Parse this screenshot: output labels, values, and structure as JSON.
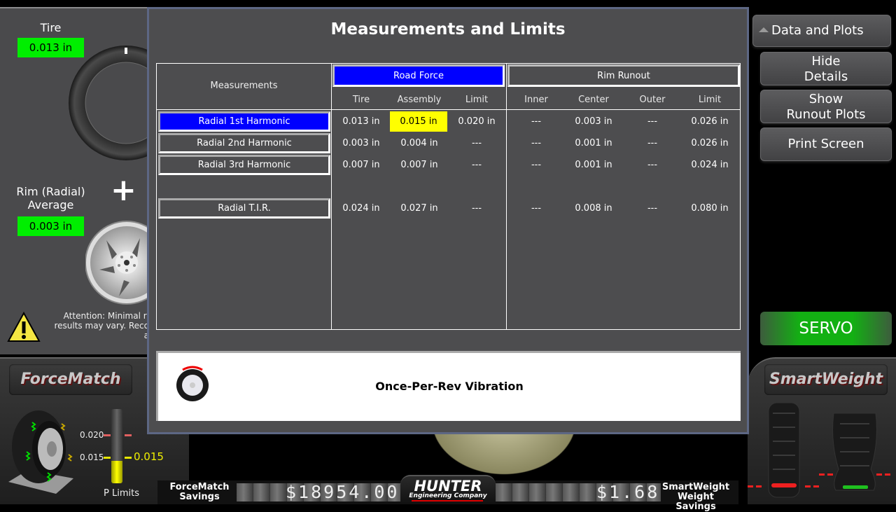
{
  "left_panel": {
    "tire_label": "Tire",
    "tire_value": "0.013 in",
    "rim_label_line1": "Rim (Radial)",
    "rim_label_line2": "Average",
    "rim_value": "0.003 in",
    "plus_sign": "+",
    "attention_line1": "Attention: Minimal ri",
    "attention_line2": "results may vary. Reco",
    "attention_line3": "a"
  },
  "modal": {
    "title": "Measurements and Limits",
    "measurements_header": "Measurements",
    "groups": {
      "road_force": "Road Force",
      "rim_runout": "Rim Runout"
    },
    "columns": {
      "road_force": [
        "Tire",
        "Assembly",
        "Limit"
      ],
      "rim_runout": [
        "Inner",
        "Center",
        "Outer",
        "Limit"
      ]
    },
    "rows": [
      {
        "label": "Radial 1st Harmonic",
        "selected": true,
        "road_force": [
          "0.013 in",
          "0.015 in",
          "0.020 in"
        ],
        "rim_runout": [
          "---",
          "0.003 in",
          "---",
          "0.026 in"
        ]
      },
      {
        "label": "Radial 2nd Harmonic",
        "selected": false,
        "road_force": [
          "0.003 in",
          "0.004 in",
          "---"
        ],
        "rim_runout": [
          "---",
          "0.001 in",
          "---",
          "0.026 in"
        ]
      },
      {
        "label": "Radial 3rd Harmonic",
        "selected": false,
        "road_force": [
          "0.007 in",
          "0.007 in",
          "---"
        ],
        "rim_runout": [
          "---",
          "0.001 in",
          "---",
          "0.024 in"
        ]
      },
      {
        "label": "Radial T.I.R.",
        "selected": false,
        "road_force": [
          "0.024 in",
          "0.027 in",
          "---"
        ],
        "rim_runout": [
          "---",
          "0.008 in",
          "---",
          "0.080 in"
        ]
      }
    ],
    "highlight_color": "#ffff00",
    "selected_color": "#0000ff",
    "vibration_label": "Once-Per-Rev Vibration",
    "vibration_icon": "wheel-vibration-icon"
  },
  "right_panel": {
    "data_plots_label": "Data and Plots",
    "hide_details_line1": "Hide",
    "hide_details_line2": "Details",
    "show_runout_line1": "Show",
    "show_runout_line2": "Runout Plots",
    "print_screen": "Print Screen",
    "servo": "SERVO"
  },
  "forcematch": {
    "logo": "ForceMatch",
    "limit_high": "0.020",
    "limit_low": "0.015",
    "current_value": "0.015",
    "gauge_fraction": 0.75,
    "gauge_label": "P Limits",
    "savings_line1": "ForceMatch",
    "savings_line2": "Savings",
    "savings_value": "$18954.00"
  },
  "hunter": {
    "brand": "HUNTER",
    "subtitle": "Engineering Company"
  },
  "smartweight": {
    "logo": "SmartWeight",
    "savings_value": "$1.68",
    "savings_line1": "SmartWeight",
    "savings_line2": "Weight Savings"
  }
}
